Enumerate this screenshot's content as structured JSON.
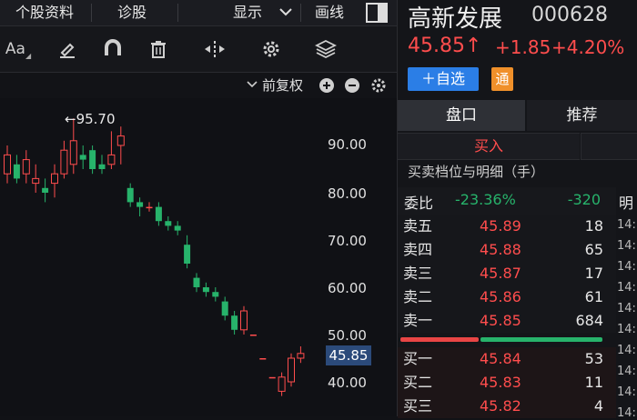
{
  "topbar": {
    "tabs": [
      "个股资料",
      "诊股"
    ],
    "display_label": "显示",
    "draw_label": "画线"
  },
  "toolbar": {
    "font_label": "Aa",
    "tools": [
      "font-icon",
      "eraser-icon",
      "magnet-icon",
      "trash-icon",
      "resize-icon",
      "settings-icon",
      "layers-icon"
    ]
  },
  "subbar": {
    "adjust_label": "前复权"
  },
  "chart_data": {
    "type": "candlestick",
    "y_ticks": [
      "90.00",
      "80.00",
      "70.00",
      "60.00",
      "50.00",
      "40.00"
    ],
    "ylim": [
      35,
      100
    ],
    "high_marker": "←95.70",
    "current_price_label": "45.85",
    "candles": [
      {
        "o": 84,
        "c": 88,
        "h": 90,
        "l": 82
      },
      {
        "o": 86,
        "c": 83,
        "h": 88,
        "l": 82
      },
      {
        "o": 84,
        "c": 87,
        "h": 89,
        "l": 82
      },
      {
        "o": 82,
        "c": 83,
        "h": 86,
        "l": 80
      },
      {
        "o": 81,
        "c": 80,
        "h": 83,
        "l": 78
      },
      {
        "o": 82,
        "c": 84,
        "h": 86,
        "l": 79
      },
      {
        "o": 84,
        "c": 89,
        "h": 91,
        "l": 83
      },
      {
        "o": 86,
        "c": 91,
        "h": 95.7,
        "l": 84
      },
      {
        "o": 88,
        "c": 87,
        "h": 90,
        "l": 85
      },
      {
        "o": 89,
        "c": 85,
        "h": 90,
        "l": 84
      },
      {
        "o": 86,
        "c": 85,
        "h": 88,
        "l": 84
      },
      {
        "o": 86,
        "c": 88,
        "h": 93,
        "l": 85
      },
      {
        "o": 90,
        "c": 92,
        "h": 94,
        "l": 86
      },
      {
        "o": 81,
        "c": 78,
        "h": 82,
        "l": 77
      },
      {
        "o": 78,
        "c": 77,
        "h": 79,
        "l": 75
      },
      {
        "o": 77,
        "c": 77,
        "h": 78,
        "l": 76
      },
      {
        "o": 77,
        "c": 74,
        "h": 78,
        "l": 73
      },
      {
        "o": 74,
        "c": 73,
        "h": 75,
        "l": 72
      },
      {
        "o": 73,
        "c": 72,
        "h": 74,
        "l": 71
      },
      {
        "o": 69,
        "c": 65,
        "h": 71,
        "l": 64
      },
      {
        "o": 62,
        "c": 60,
        "h": 63,
        "l": 59
      },
      {
        "o": 60,
        "c": 59,
        "h": 61,
        "l": 58
      },
      {
        "o": 59,
        "c": 58,
        "h": 60,
        "l": 57
      },
      {
        "o": 57,
        "c": 54,
        "h": 58,
        "l": 53
      },
      {
        "o": 54,
        "c": 51,
        "h": 55,
        "l": 50
      },
      {
        "o": 51,
        "c": 55,
        "h": 56,
        "l": 50
      },
      {
        "o": 50,
        "c": 50,
        "h": 50,
        "l": 50
      },
      {
        "o": 45,
        "c": 45,
        "h": 45,
        "l": 45
      },
      {
        "o": 41,
        "c": 41,
        "h": 41,
        "l": 41
      },
      {
        "o": 38,
        "c": 41,
        "h": 42,
        "l": 37
      },
      {
        "o": 40,
        "c": 45,
        "h": 46,
        "l": 39
      },
      {
        "o": 45,
        "c": 46,
        "h": 47.5,
        "l": 44
      }
    ]
  },
  "stock": {
    "name": "高新发展",
    "code": "000628",
    "price": "45.85↑",
    "change": "+1.85",
    "change_pct": "+4.20%",
    "add_watch_label": "＋自选",
    "tong_label": "通"
  },
  "panel": {
    "tabs": [
      "盘口",
      "推荐"
    ],
    "buy_label": "买入",
    "section_title": "买卖档位与明细（手）",
    "weibi_label": "委比",
    "weibi_pct": "-23.36%",
    "weibi_val": "-320",
    "detail_col": "明",
    "asks": [
      {
        "label": "卖五",
        "price": "45.89",
        "vol": "18"
      },
      {
        "label": "卖四",
        "price": "45.88",
        "vol": "65"
      },
      {
        "label": "卖三",
        "price": "45.87",
        "vol": "17"
      },
      {
        "label": "卖二",
        "price": "45.86",
        "vol": "61"
      },
      {
        "label": "卖一",
        "price": "45.85",
        "vol": "684"
      }
    ],
    "bids": [
      {
        "label": "买一",
        "price": "45.84",
        "vol": "53"
      },
      {
        "label": "买二",
        "price": "45.83",
        "vol": "11"
      },
      {
        "label": "买三",
        "price": "45.82",
        "vol": "4"
      }
    ],
    "tick_times": [
      "14:",
      "14:",
      "14:",
      "14:",
      "14:",
      "14:",
      "14:",
      "14:",
      "14:",
      "14:"
    ],
    "colors": {
      "up": "#ff4d4d",
      "down": "#27b36b",
      "accent": "#2b7ee6"
    }
  }
}
